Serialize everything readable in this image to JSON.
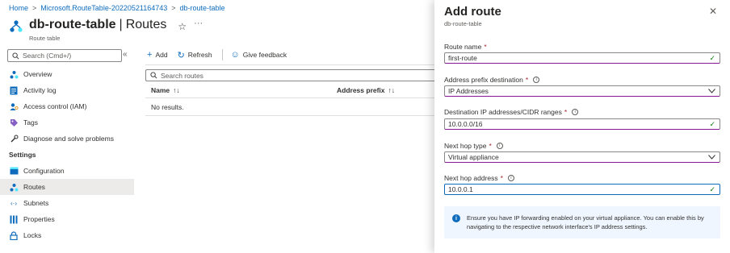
{
  "breadcrumb": {
    "items": [
      "Home",
      "Microsoft.RouteTable-20220521164743",
      "db-route-table"
    ],
    "separator": ">"
  },
  "header": {
    "name": "db-route-table",
    "section": "Routes",
    "subtitle": "Route table",
    "star_icon": "star-icon",
    "more_icon": "more-icon"
  },
  "sidebar": {
    "search_placeholder": "Search (Cmd+/)",
    "collapse": "«",
    "items": [
      {
        "label": "Overview",
        "icon": "overview-icon"
      },
      {
        "label": "Activity log",
        "icon": "activity-log-icon"
      },
      {
        "label": "Access control (IAM)",
        "icon": "iam-icon"
      },
      {
        "label": "Tags",
        "icon": "tag-icon"
      },
      {
        "label": "Diagnose and solve problems",
        "icon": "wrench-icon"
      }
    ],
    "settings_title": "Settings",
    "settings_items": [
      {
        "label": "Configuration",
        "icon": "configuration-icon"
      },
      {
        "label": "Routes",
        "icon": "routes-icon"
      },
      {
        "label": "Subnets",
        "icon": "subnets-icon"
      },
      {
        "label": "Properties",
        "icon": "properties-icon"
      },
      {
        "label": "Locks",
        "icon": "lock-icon"
      }
    ]
  },
  "toolbar": {
    "add": "Add",
    "refresh": "Refresh",
    "feedback": "Give feedback"
  },
  "routes_table": {
    "search_placeholder": "Search routes",
    "columns": [
      "Name",
      "Address prefix"
    ],
    "sort_glyph": "↑↓",
    "empty_text": "No results."
  },
  "panel": {
    "title": "Add route",
    "subtitle": "db-route-table",
    "close": "✕",
    "fields": {
      "route_name": {
        "label": "Route name",
        "value": "first-route"
      },
      "prefix_dest": {
        "label": "Address prefix destination",
        "value": "IP Addresses"
      },
      "cidr": {
        "label": "Destination IP addresses/CIDR ranges",
        "value": "10.0.0.0/16"
      },
      "next_hop_type": {
        "label": "Next hop type",
        "value": "Virtual appliance"
      },
      "next_hop_address": {
        "label": "Next hop address",
        "value": "10.0.0.1"
      }
    },
    "required_mark": "*",
    "info_mark": "i",
    "info_text": "Ensure you have IP forwarding enabled on your virtual appliance. You can enable this by navigating to the respective network interface's IP address settings."
  },
  "colors": {
    "accent": "#0f6cbd",
    "valid_underline": "#881798",
    "success": "#107c10",
    "required": "#a4262c",
    "info_bg": "#f0f6ff"
  }
}
